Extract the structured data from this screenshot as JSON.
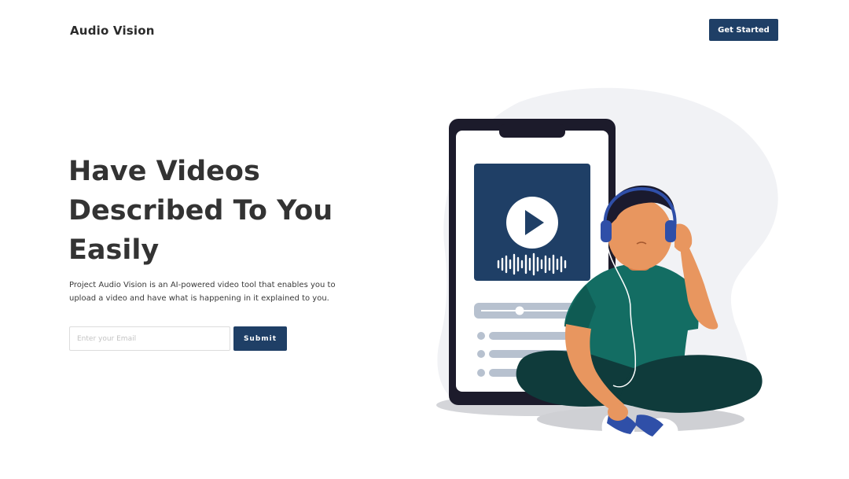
{
  "header": {
    "brand": "Audio Vision",
    "cta_label": "Get Started"
  },
  "hero": {
    "title_lines": [
      "Have Videos",
      "Described To You",
      "Easily"
    ],
    "description": "Project Audio Vision is an AI-powered video tool that enables you to upload a video and have what is happening in it explained to you."
  },
  "form": {
    "email_placeholder": "Enter your Email",
    "email_value": "",
    "submit_label": "Submit"
  },
  "colors": {
    "primary": "#1f3f66",
    "text": "#333333",
    "shirt": "#136d63",
    "pants": "#0f3b3b",
    "skin": "#e8965f"
  },
  "icons": {
    "play": "play-icon",
    "headphones": "headphones-icon",
    "waveform": "audio-waveform-icon"
  }
}
